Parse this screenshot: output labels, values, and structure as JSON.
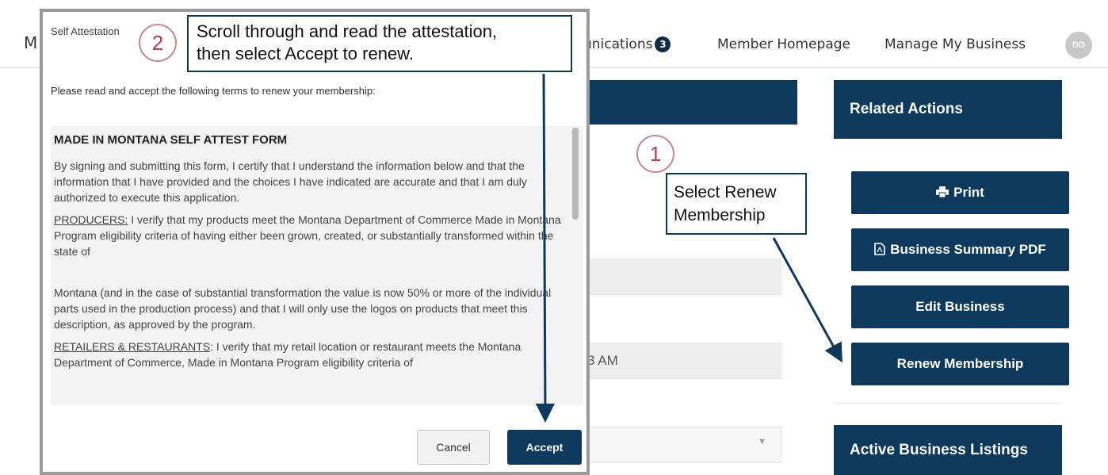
{
  "nav": {
    "partial_left": "M",
    "communications_label": "unications",
    "communications_count": "3",
    "member_homepage": "Member Homepage",
    "manage_my_business": "Manage My Business",
    "avatar_initials": "DD"
  },
  "background": {
    "field_time_partial": "3 AM"
  },
  "related_actions": {
    "title": "Related Actions",
    "print_label": "Print",
    "pdf_label": "Business Summary PDF",
    "edit_label": "Edit Business",
    "renew_label": "Renew Membership"
  },
  "active_listings": {
    "title": "Active Business Listings"
  },
  "modal": {
    "title": "Self Attestation",
    "intro": "Please read and accept the following terms to renew your membership:",
    "heading": "MADE IN MONTANA SELF ATTEST FORM",
    "p1": "By signing and submitting this form, I certify that I understand the  information below and that the information that I have provided and the choices I have indicated are accurate and that I am duly authorized to execute this application.",
    "p2_label": "PRODUCERS:",
    "p2": " I verify that my products meet the Montana Department of Commerce Made in Montana Program eligibility criteria of having either been grown, created, or substantially transformed within the state of",
    "p3": "Montana (and in the case of substantial transformation the value is now 50% or more of the individual parts used in the production process) and that I will only use the logos on products that meet this description, as approved by the program.",
    "p4_label": "RETAILERS & RESTAURANTS",
    "p4": ": I verify that my retail location or restaurant meets the Montana Department of Commerce, Made in Montana Program eligibility criteria of",
    "cancel_label": "Cancel",
    "accept_label": "Accept"
  },
  "callouts": {
    "step1_number": "1",
    "step1_text": "Select Renew Membership",
    "step2_number": "2",
    "step2_line1": "Scroll through and read the attestation,",
    "step2_line2": "then select Accept to renew."
  },
  "colors": {
    "brand_navy": "#0d3a5c",
    "callout_number_red": "#c23b4b"
  }
}
